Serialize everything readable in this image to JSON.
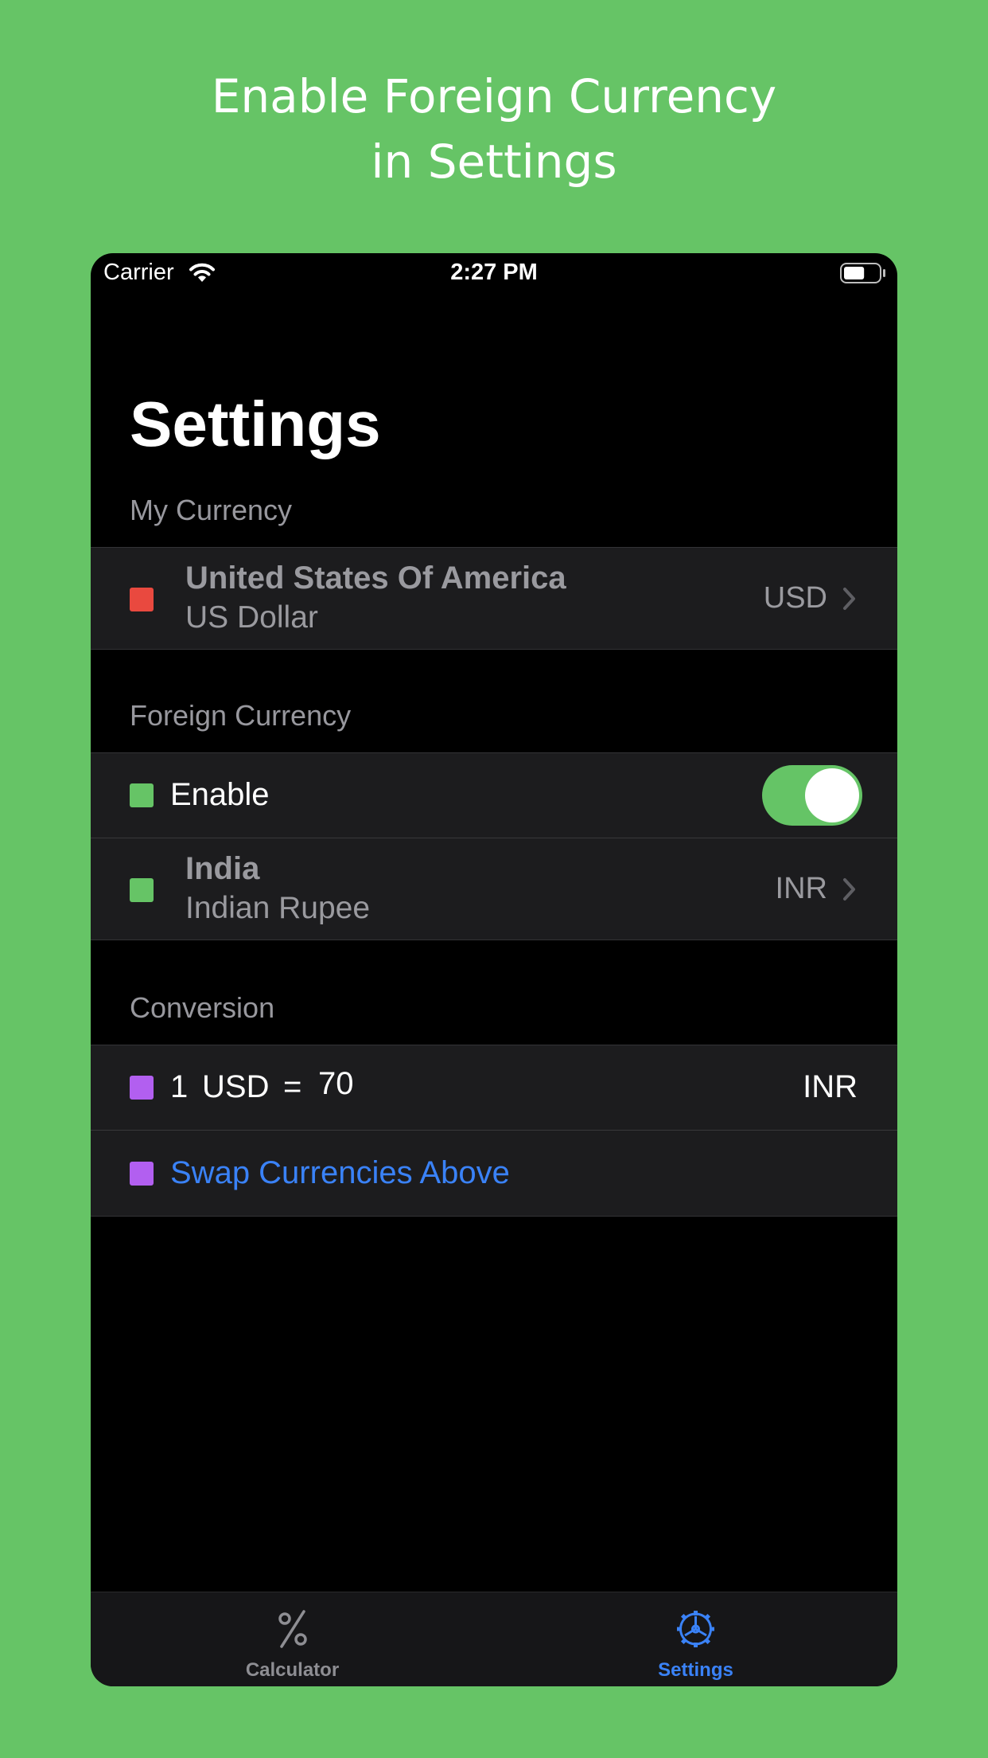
{
  "banner": {
    "line1": "Enable Foreign Currency",
    "line2": "in Settings"
  },
  "status_bar": {
    "carrier": "Carrier",
    "time": "2:27 PM",
    "battery_level": 0.6
  },
  "page": {
    "title": "Settings"
  },
  "my_currency": {
    "header": "My Currency",
    "swatch_color": "#e9493f",
    "country": "United States Of America",
    "currency_name": "US Dollar",
    "code": "USD"
  },
  "foreign_currency": {
    "header": "Foreign Currency",
    "enable_label": "Enable",
    "enable_swatch_color": "#66c466",
    "enabled": true,
    "swatch_color": "#66c466",
    "country": "India",
    "currency_name": "Indian Rupee",
    "code": "INR"
  },
  "conversion": {
    "header": "Conversion",
    "swatch_color": "#b25ff0",
    "amount": "1",
    "from_code": "USD",
    "equals": "=",
    "rate": "70",
    "to_code": "INR",
    "swap_label": "Swap Currencies Above",
    "swap_swatch_color": "#b25ff0"
  },
  "tab_bar": {
    "tabs": [
      {
        "label": "Calculator",
        "icon": "percent-icon",
        "selected": false
      },
      {
        "label": "Settings",
        "icon": "gear-icon",
        "selected": true
      }
    ]
  },
  "colors": {
    "accent_blue": "#3a82f7",
    "background_green": "#66c466",
    "cell_background": "#1c1c1e"
  }
}
